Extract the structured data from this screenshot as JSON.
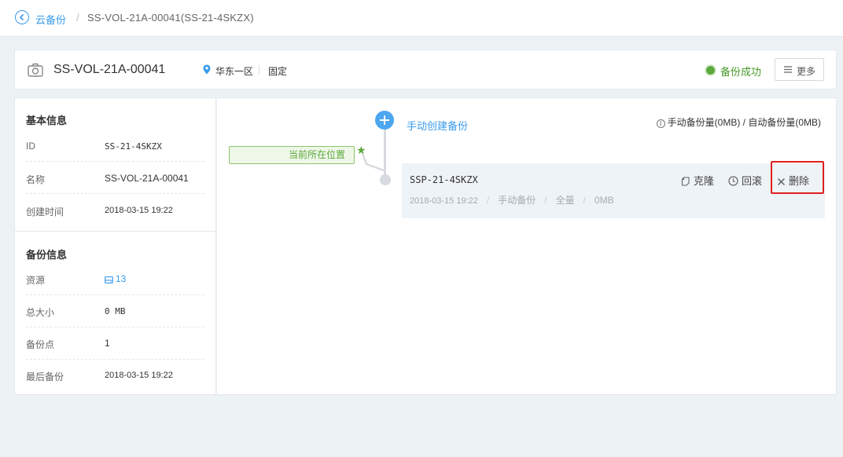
{
  "breadcrumb": {
    "back_icon": "chevron-left-circle-icon",
    "parent": "云备份",
    "separator": "/",
    "current": "SS-VOL-21A-00041(SS-21-4SKZX)"
  },
  "header": {
    "icon": "camera-icon",
    "title": "SS-VOL-21A-00041",
    "location_icon": "map-pin-icon",
    "region": "华东一区",
    "tag": "固定",
    "status": "备份成功",
    "status_color": "#5ca83b",
    "more_label": "更多"
  },
  "basic_info": {
    "title": "基本信息",
    "rows": [
      {
        "label": "ID",
        "value": "SS-21-4SKZX"
      },
      {
        "label": "名称",
        "value": "SS-VOL-21A-00041"
      },
      {
        "label": "创建时间",
        "value": "2018-03-15 19:22"
      }
    ]
  },
  "backup_info": {
    "title": "备份信息",
    "resource_label": "资源",
    "resource_icon": "disk-icon",
    "resource_value": "13",
    "rows": [
      {
        "label": "总大小",
        "value": "0 MB"
      },
      {
        "label": "备份点",
        "value": "1"
      },
      {
        "label": "最后备份",
        "value": "2018-03-15 19:22"
      }
    ]
  },
  "timeline": {
    "add_label": "手动创建备份",
    "quota": "手动备份量(0MB) / 自动备份量(0MB)",
    "current_position": "当前所在位置",
    "snapshot": {
      "name": "SSP-21-4SKZX",
      "date": "2018-03-15 19:22",
      "type": "手动备份",
      "mode": "全量",
      "size": "0MB",
      "sep": "/",
      "clone_label": "克隆",
      "rollback_label": "回滚",
      "delete_label": "删除"
    }
  },
  "colors": {
    "accent": "#3a9cec",
    "success": "#5ca83b",
    "highlight": "#e02020"
  }
}
